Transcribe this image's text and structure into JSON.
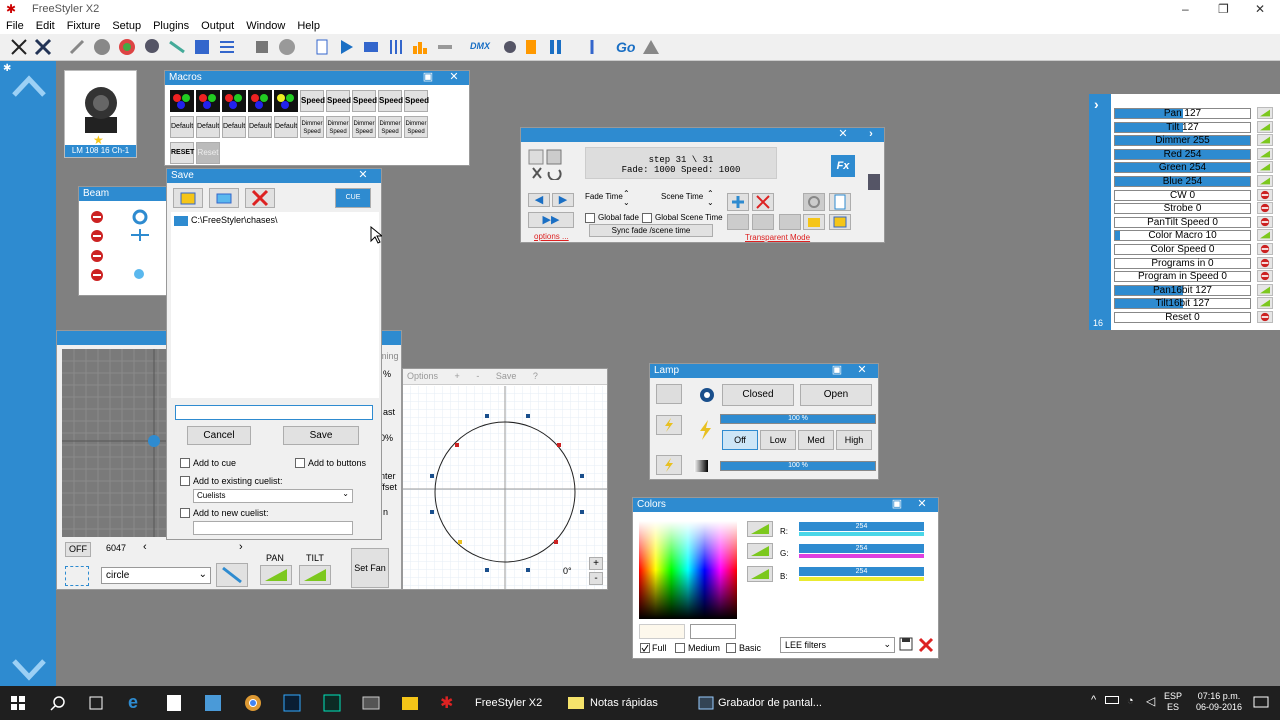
{
  "app": {
    "title": "FreeStyler X2",
    "min": "–",
    "max": "❐",
    "close": "✕"
  },
  "menu": [
    "File",
    "Edit",
    "Fixture",
    "Setup",
    "Plugins",
    "Output",
    "Window",
    "Help"
  ],
  "toolbar": {
    "dmx_label": "DMX",
    "go_label": "Go"
  },
  "fixture": {
    "label": "LM 108 16 Ch-1"
  },
  "macros": {
    "title": "Macros",
    "speed": "Speed",
    "default": "Default",
    "dimmer_speed": "Dimmer Speed",
    "reset_upper": "RESET",
    "reset": "Reset"
  },
  "beam": {
    "title": "Beam"
  },
  "save": {
    "title": "Save",
    "path": "C:\\FreeStyler\\chases\\",
    "name_value": "",
    "cancel": "Cancel",
    "save": "Save",
    "add_to_cue": "Add to cue",
    "add_to_buttons": "Add to buttons",
    "add_existing": "Add to existing cuelist:",
    "cuelists": "Cuelists",
    "add_new": "Add to new cuelist:",
    "cue_icon": "CUE"
  },
  "cue": {
    "step": "step 31 \\ 31",
    "fade_line": "Fade: 1000 Speed: 1000",
    "fade_time": "Fade Time",
    "scene_time": "Scene Time",
    "global_fade": "Global fade",
    "global_scene": "Global Scene Time",
    "sync": "Sync fade /scene time",
    "options": "options ...",
    "transparent": "Transparent Mode",
    "fx": "Fx"
  },
  "movement": {
    "off": "OFF",
    "value": "6047",
    "shape": "circle",
    "pan": "PAN",
    "tilt": "TILT",
    "set_fan": "Set Fan",
    "timing": "ming",
    "pct1": "%",
    "pct2": "0%",
    "last": "ast",
    "center": "nter",
    "offset": "ffset",
    "n": "n"
  },
  "shape_editor": {
    "options": "Options",
    "plus": "+",
    "minus": "-",
    "save": "Save",
    "help": "?",
    "degrees": "0°",
    "zoom_in": "+",
    "zoom_out": "-"
  },
  "lamp": {
    "title": "Lamp",
    "closed": "Closed",
    "open": "Open",
    "pct1": "100 %",
    "off": "Off",
    "low": "Low",
    "med": "Med",
    "high": "High",
    "pct2": "100 %"
  },
  "colors": {
    "title": "Colors",
    "r_label": "R:",
    "g_label": "G:",
    "b_label": "B:",
    "r_val": "254",
    "g_val": "254",
    "b_val": "254",
    "full": "Full",
    "medium": "Medium",
    "basic": "Basic",
    "filter": "LEE filters"
  },
  "channels": {
    "footer": "16",
    "items": [
      {
        "label": "Pan  127",
        "fill": 0.5
      },
      {
        "label": "Tilt  127",
        "fill": 0.5
      },
      {
        "label": "Dimmer   255",
        "fill": 1
      },
      {
        "label": "Red   254",
        "fill": 1
      },
      {
        "label": "Green   254",
        "fill": 1
      },
      {
        "label": "Blue   254",
        "fill": 1
      },
      {
        "label": "CW   0",
        "fill": 0
      },
      {
        "label": "Strobe   0",
        "fill": 0
      },
      {
        "label": "PanTilt Speed   0",
        "fill": 0
      },
      {
        "label": "Color Macro   10",
        "fill": 0.04
      },
      {
        "label": "Color Speed   0",
        "fill": 0
      },
      {
        "label": "Programs in   0",
        "fill": 0
      },
      {
        "label": "Program in Speed   0",
        "fill": 0
      },
      {
        "label": "Pan16bit   127",
        "fill": 0.5
      },
      {
        "label": "Tilt16bit   127",
        "fill": 0.5
      },
      {
        "label": "Reset   0",
        "fill": 0
      }
    ]
  },
  "taskbar": {
    "freestyler": "FreeStyler X2",
    "notas": "Notas rápidas",
    "grabador": "Grabador de pantal...",
    "lang1": "ESP",
    "lang2": "ES",
    "time": "07:16 p.m.",
    "date": "06-09-2016"
  }
}
